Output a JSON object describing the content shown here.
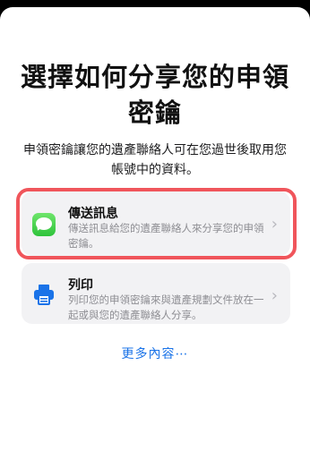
{
  "sheet": {
    "title": "選擇如何分享您的申領密鑰",
    "subtitle": "申領密鑰讓您的遺產聯絡人可在您過世後取用您帳號中的資料。"
  },
  "options": [
    {
      "title": "傳送訊息",
      "description": "傳送訊息給您的遺產聯絡人來分享您的申領密鑰。",
      "icon": "messages-icon",
      "icon_color": "#34c759",
      "highlighted": true
    },
    {
      "title": "列印",
      "description": "列印您的申領密鑰來與遺產規劃文件放在一起或與您的遺產聯絡人分享。",
      "icon": "printer-icon",
      "icon_color": "#1a73e8",
      "highlighted": false
    }
  ],
  "more_link": "更多內容⋯",
  "colors": {
    "accent": "#1a73e8",
    "highlight_border": "#f0555b",
    "card_background": "#f2f2f4"
  }
}
